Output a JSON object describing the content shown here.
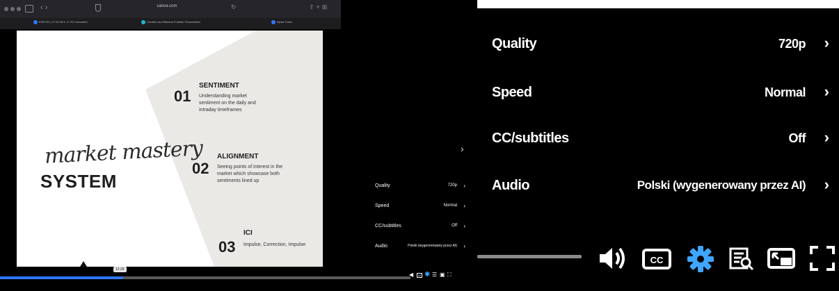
{
  "browser": {
    "url": "canva.com",
    "tabs": [
      {
        "label": "ESPU33 | 27.05.08 ▾ -0.71% Unnamed",
        "color": "#2f77ff"
      },
      {
        "label": "Creative and Minimal Portfolio Presentation",
        "color": "#22b8cf"
      },
      {
        "label": "Alpha Times",
        "color": "#2f77ff"
      }
    ]
  },
  "slide": {
    "script_title": "market mastery",
    "title": "SYSTEM",
    "sections": [
      {
        "number": "01",
        "heading": "SENTIMENT",
        "text": "Understanding market sentiment on the daily and intraday timeframes"
      },
      {
        "number": "02",
        "heading": "ALIGNMENT",
        "text": "Seeing points of interest in the market which showcase both sentiments lined up"
      },
      {
        "number": "03",
        "heading": "ICI",
        "text": "Impulse, Correction, Impulse"
      }
    ]
  },
  "player": {
    "progress_fraction": 0.3,
    "time_tooltip": "12:29",
    "settings": [
      {
        "label": "Quality",
        "value": "720p"
      },
      {
        "label": "Speed",
        "value": "Normal"
      },
      {
        "label": "CC/subtitles",
        "value": "Off"
      },
      {
        "label": "Audio",
        "value": "Polski (wygenerowany przez AI)"
      }
    ],
    "controls": [
      "volume-icon",
      "captions-icon",
      "settings-gear-icon",
      "transcript-icon",
      "miniplayer-icon",
      "fullscreen-icon"
    ],
    "accent_color": "#2f77ff",
    "gear_color": "#3ea6ff"
  }
}
